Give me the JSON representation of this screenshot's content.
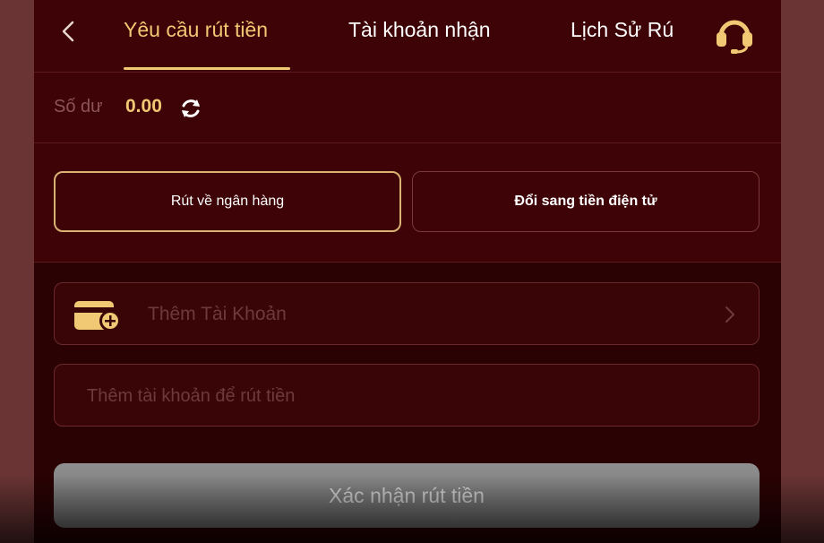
{
  "header": {
    "tabs": [
      {
        "label": "Yêu cầu rút tiền",
        "active": true
      },
      {
        "label": "Tài khoản nhận",
        "active": false
      },
      {
        "label": "Lịch Sử Rú",
        "active": false
      }
    ]
  },
  "balance": {
    "label": "Số dư",
    "value": "0.00"
  },
  "methods": [
    {
      "label": "Rút về ngân hàng",
      "active": true
    },
    {
      "label": "Đổi sang tiền điện tử",
      "active": false
    }
  ],
  "form": {
    "add_account_label": "Thêm Tài Khoản",
    "account_placeholder": "Thêm tài khoản để rút tiền",
    "confirm_label": "Xác nhận rút tiền"
  },
  "colors": {
    "background": "#3d0306",
    "accent_gold": "#f1c873",
    "disabled_button": "#7f7f7f"
  },
  "icons": {
    "back": "chevron-left-icon",
    "support": "headset-icon",
    "refresh": "refresh-icon",
    "wallet": "wallet-add-icon",
    "chevron": "chevron-right-icon"
  }
}
